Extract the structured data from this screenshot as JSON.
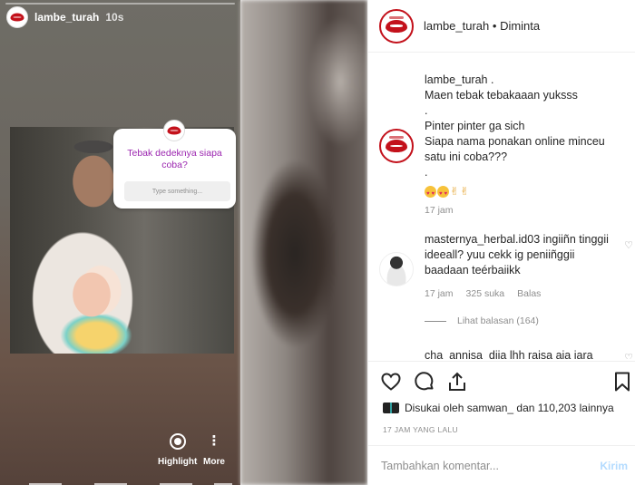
{
  "story": {
    "username": "lambe_turah",
    "time": "10s",
    "quiz": {
      "question": "Tebak dedeknya siapa coba?",
      "input_placeholder": "Type something..."
    },
    "actions": {
      "highlight_label": "Highlight",
      "more_label": "More"
    }
  },
  "post": {
    "header": {
      "username": "lambe_turah",
      "separator": " • ",
      "status": "Diminta"
    },
    "caption": {
      "username": "lambe_turah .",
      "lines": [
        "Maen tebak tebakaaan yuksss",
        ".",
        "Pinter pinter ga sich",
        "Siapa nama ponakan online minceu satu ini coba???",
        "."
      ],
      "time": "17 jam"
    },
    "comments": [
      {
        "username": "masternya_herbal.id03",
        "text": "ingiiñn tinggii ideeall? yuu cekk ig peniiñggii baadaan teérbaiikk",
        "time": "17 jam",
        "likes": "325 suka",
        "reply_label": "Balas",
        "view_replies": "Lihat balasan (164)"
      },
      {
        "username": "cha_annisa_djia",
        "text": "lhh raisa aja jara"
      }
    ],
    "likes": {
      "prefix": "Disukai oleh ",
      "user": "samwan_",
      "middle": " dan ",
      "count": "110,203",
      "suffix": " lainnya"
    },
    "timestamp": "17 JAM YANG LALU",
    "add_comment": {
      "placeholder": "Tambahkan komentar...",
      "post_label": "Kirim"
    }
  },
  "icons": [
    "heart-icon",
    "comment-icon",
    "share-icon",
    "bookmark-icon",
    "heart-small-icon"
  ],
  "colors": {
    "brand_red": "#c3111b",
    "quiz_purple": "#9c27b0",
    "link_blue": "#b3dbff"
  }
}
